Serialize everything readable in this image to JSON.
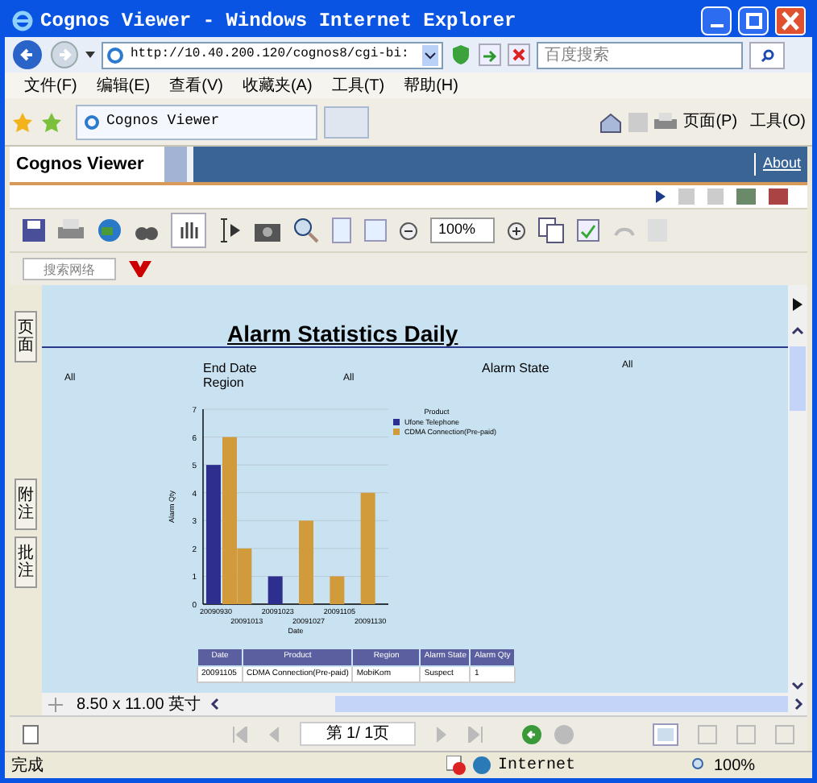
{
  "window": {
    "title": "Cognos Viewer - Windows Internet Explorer"
  },
  "address_bar": {
    "url": "http://10.40.200.120/cognos8/cgi-bi:",
    "search_placeholder": "百度搜索"
  },
  "menu": [
    "文件(F)",
    "编辑(E)",
    "查看(V)",
    "收藏夹(A)",
    "工具(T)",
    "帮助(H)"
  ],
  "browser_tabs": [
    {
      "label": "Cognos Viewer",
      "selected": true
    }
  ],
  "command_bar": [
    "页面(P)",
    "工具(O)"
  ],
  "viewer": {
    "title": "Cognos Viewer",
    "about_link": "About",
    "zoom": "100%",
    "search_placeholder": "搜索网络"
  },
  "side_tabs": [
    "页面",
    "附注",
    "批注"
  ],
  "report": {
    "title": "Alarm Statistics Daily",
    "filters": [
      {
        "value": "All"
      },
      {
        "label": "End Date"
      },
      {
        "label": "Region",
        "value": "All"
      },
      {
        "label": "Alarm State",
        "value": "All"
      }
    ],
    "chart_data": {
      "type": "bar",
      "xlabel": "Date",
      "ylabel": "Alarm Qty",
      "grid": true,
      "legend": {
        "title": "Product"
      },
      "categories": [
        "20090930",
        "20091013",
        "20091023",
        "20091027",
        "20091105",
        "20091130"
      ],
      "series": [
        {
          "name": "Ufone Telephone",
          "color": "#2e2e8f",
          "values": [
            5,
            null,
            1,
            null,
            null,
            null
          ]
        },
        {
          "name": "CDMA Connection(Pre-paid)",
          "color": "#d19a3a",
          "values": [
            6,
            2,
            null,
            3,
            1,
            4
          ]
        }
      ],
      "ylim": [
        0,
        7
      ],
      "yticks": [
        0,
        1,
        2,
        3,
        4,
        5,
        6,
        7
      ]
    },
    "table": {
      "columns": [
        "Date",
        "Product",
        "Region",
        "Alarm State",
        "Alarm Qty"
      ],
      "rows": [
        [
          "20091105",
          "CDMA Connection(Pre-paid)",
          "MobiKom",
          "Suspect",
          "1"
        ]
      ]
    }
  },
  "page_size": "8.50 x 11.00 英寸",
  "pager": "第 1/ 1页",
  "status_bar": {
    "text": "完成",
    "zone": "Internet",
    "zoom": "100%"
  }
}
